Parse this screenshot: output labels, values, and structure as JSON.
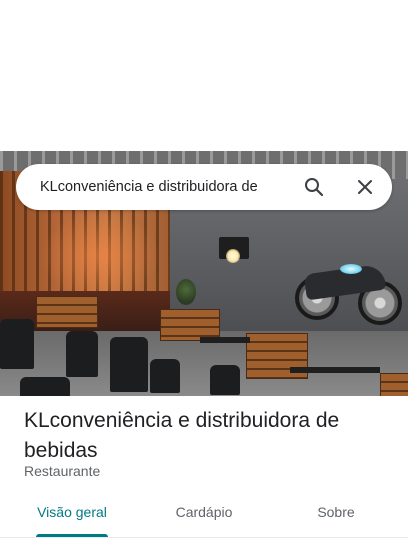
{
  "search": {
    "query": "KLconveniência e distribuidora de",
    "search_icon": "search-icon",
    "clear_icon": "close-icon"
  },
  "photo": {
    "description_icon": "restaurant-photo"
  },
  "place": {
    "title": "KLconveniência e distribuidora de bebidas",
    "category": "Restaurante"
  },
  "tabs": [
    {
      "label": "Visão geral",
      "active": true
    },
    {
      "label": "Cardápio",
      "active": false
    },
    {
      "label": "Sobre",
      "active": false
    }
  ],
  "colors": {
    "accent": "#007b83",
    "text_primary": "#202124",
    "text_secondary": "#5f6368"
  }
}
